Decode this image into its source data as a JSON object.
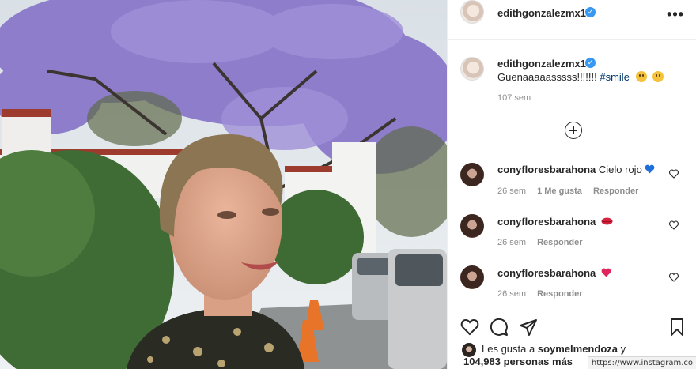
{
  "post": {
    "owner": "edithgonzalezmx1",
    "caption_text": "Guenaaaaasssss!!!!!!!",
    "caption_hashtag": "#smile",
    "caption_time": "107 sem",
    "emojis": [
      "grinning-face",
      "winking-face-tongue"
    ]
  },
  "comments": [
    {
      "user": "conyfloresbarahona",
      "text": "Cielo rojo",
      "emoji": "blue-heart",
      "time": "26 sem",
      "likes": "1 Me gusta",
      "reply": "Responder"
    },
    {
      "user": "conyfloresbarahona",
      "text": "",
      "emoji": "kiss-lips",
      "time": "26 sem",
      "likes": "",
      "reply": "Responder"
    },
    {
      "user": "conyfloresbarahona",
      "text": "",
      "emoji": "red-heart",
      "time": "26 sem",
      "likes": "",
      "reply": "Responder"
    }
  ],
  "likes": {
    "prefix": "Les gusta a",
    "first_user": "soymelmendoza",
    "connector": "y",
    "count": "104,983 personas más"
  },
  "status_bar": {
    "url": "https://www.instagram.co"
  },
  "colors": {
    "verified": "#3897f0",
    "hashtag": "#00376b",
    "muted": "#8e8e8e",
    "blue_heart": "#1e6fd9",
    "red_heart": "#e0245e"
  },
  "icons": [
    "more-options-icon",
    "plus-circle-icon",
    "heart-icon",
    "comment-icon",
    "share-icon",
    "bookmark-icon",
    "verified-icon"
  ]
}
